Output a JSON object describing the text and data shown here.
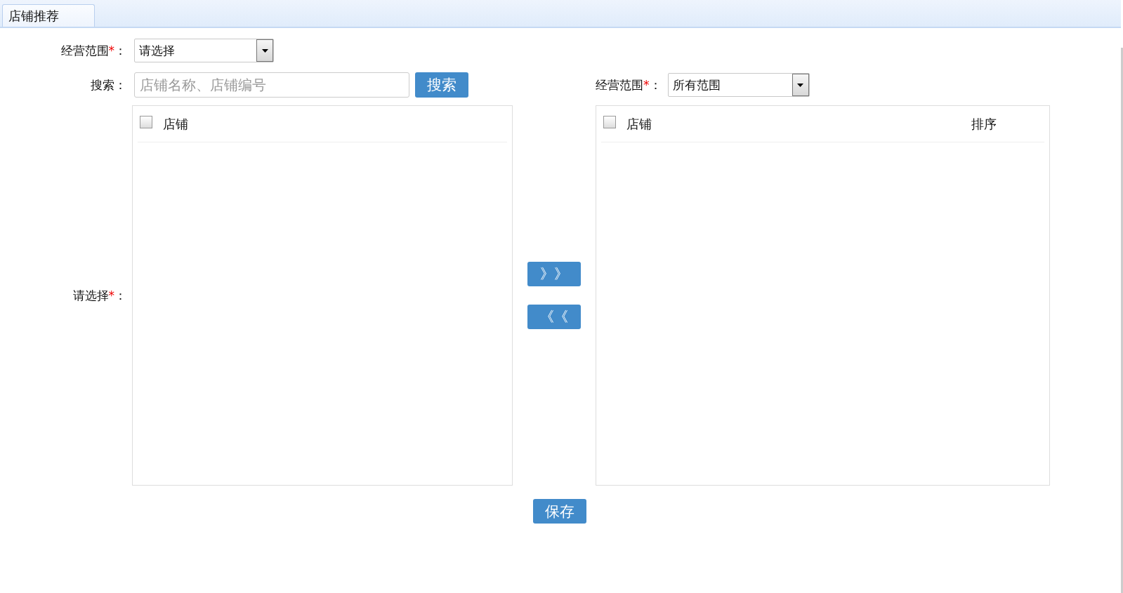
{
  "tabs": [
    {
      "label": "店铺推荐",
      "selected": true
    }
  ],
  "scope_field": {
    "label": "经营范围",
    "mark": "*",
    "colon": "：",
    "value": "请选择"
  },
  "search": {
    "label": "搜索",
    "colon": "：",
    "placeholder": "店铺名称、店铺编号",
    "button": "搜索"
  },
  "right_scope_field": {
    "label": "经营范围",
    "mark": "*",
    "colon": "：",
    "value": "所有范围"
  },
  "choose_label": {
    "label": "请选择",
    "mark": "*",
    "colon": "："
  },
  "left_list": {
    "checked": false,
    "columns": [
      "店铺"
    ]
  },
  "move_buttons": [
    "》》",
    "《《"
  ],
  "right_list": {
    "checked": false,
    "columns": [
      "店铺",
      "排序"
    ]
  },
  "save_button": "保存"
}
